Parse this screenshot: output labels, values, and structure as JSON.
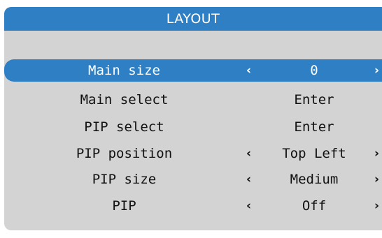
{
  "header": {
    "title": "LAYOUT"
  },
  "arrows": {
    "left": "‹",
    "right": "›"
  },
  "menu": {
    "selected_index": 0,
    "rows": [
      {
        "label": "Main size",
        "value": "0"
      },
      {
        "label": "Main select",
        "value": "Enter"
      },
      {
        "label": "PIP select",
        "value": "Enter"
      },
      {
        "label": "PIP position",
        "value": "Top Left"
      },
      {
        "label": "PIP size",
        "value": "Medium"
      },
      {
        "label": "PIP",
        "value": "Off"
      }
    ]
  },
  "colors": {
    "accent": "#2e7fc4",
    "panel": "#d3d3d3",
    "text": "#111111",
    "selected_text": "#ffffff"
  }
}
